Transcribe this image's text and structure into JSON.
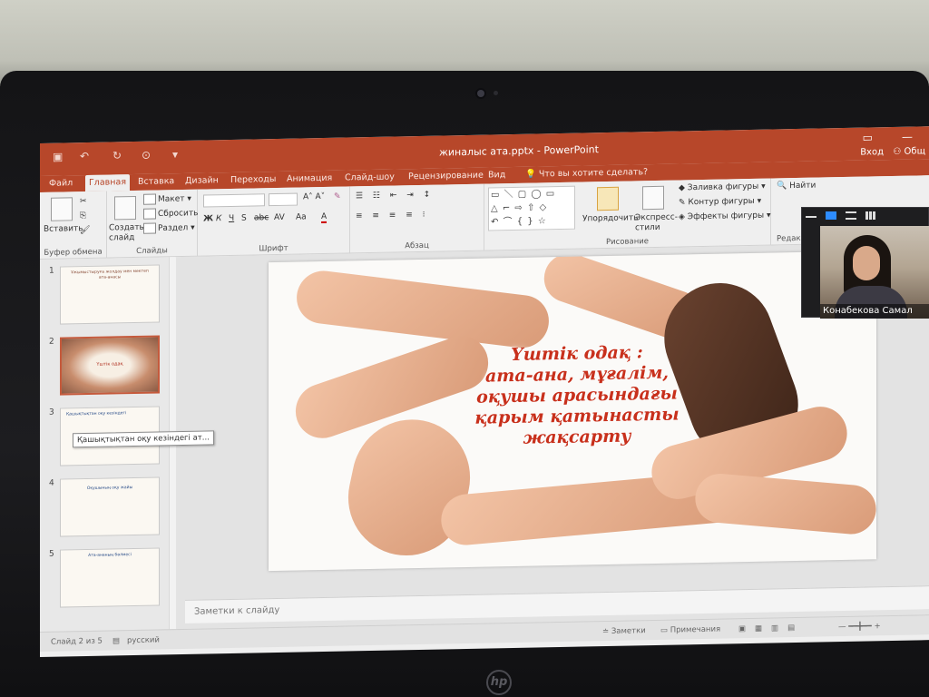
{
  "window": {
    "title": "жиналыс ата.pptx - PowerPoint",
    "sign_in": "Вход",
    "share": "Общ"
  },
  "tabs": [
    "Файл",
    "Главная",
    "Вставка",
    "Дизайн",
    "Переходы",
    "Анимация",
    "Слайд-шоу",
    "Рецензирование",
    "Вид"
  ],
  "tell_me": "Что вы хотите сделать?",
  "ribbon": {
    "clipboard": {
      "paste": "Вставить",
      "label": "Буфер обмена"
    },
    "slides": {
      "new_slide": "Создать слайд",
      "layout": "Макет",
      "reset": "Сбросить",
      "section": "Раздел",
      "label": "Слайды"
    },
    "font": {
      "label": "Шрифт",
      "bold": "Ж",
      "italic": "К",
      "underline": "Ч",
      "strike": "S",
      "shadow": "abc",
      "spacing": "AV",
      "case": "Aa",
      "color": "A"
    },
    "paragraph": {
      "label": "Абзац"
    },
    "drawing": {
      "arrange": "Упорядочить",
      "quick_styles": "Экспресс-стили",
      "fill": "Заливка фигуры",
      "outline": "Контур фигуры",
      "effects": "Эффекты фигуры",
      "label": "Рисование"
    },
    "editing": {
      "find": "Найти",
      "label": "Редак"
    }
  },
  "thumbnails": [
    {
      "num": "1",
      "text": "Ұжымыстыруға жолдау мен мектеп ата-анасы"
    },
    {
      "num": "2",
      "text": "Үштік одақ"
    },
    {
      "num": "3",
      "text": "Қашықтықтан оқу кезіндегі"
    },
    {
      "num": "4",
      "text": "Оқушының оқу жайы"
    },
    {
      "num": "5",
      "text": "Ата-ананың бөлмесі"
    }
  ],
  "tooltip": "Қашықтықтан оқу кезіндегі ат...",
  "slide": {
    "lines": [
      "Үштік одақ :",
      "ата-ана, мұғалім,",
      "оқушы арасындағы",
      "қарым қатынасты",
      "жақсарту"
    ]
  },
  "notes_placeholder": "Заметки к слайду",
  "status": {
    "slide_counter": "Слайд 2 из 5",
    "language": "русский",
    "notes": "Заметки",
    "comments": "Примечания"
  },
  "zoom": {
    "participant": "Конабекова Самал"
  },
  "colors": {
    "accent": "#b7472a",
    "slide_text": "#c8301c"
  }
}
